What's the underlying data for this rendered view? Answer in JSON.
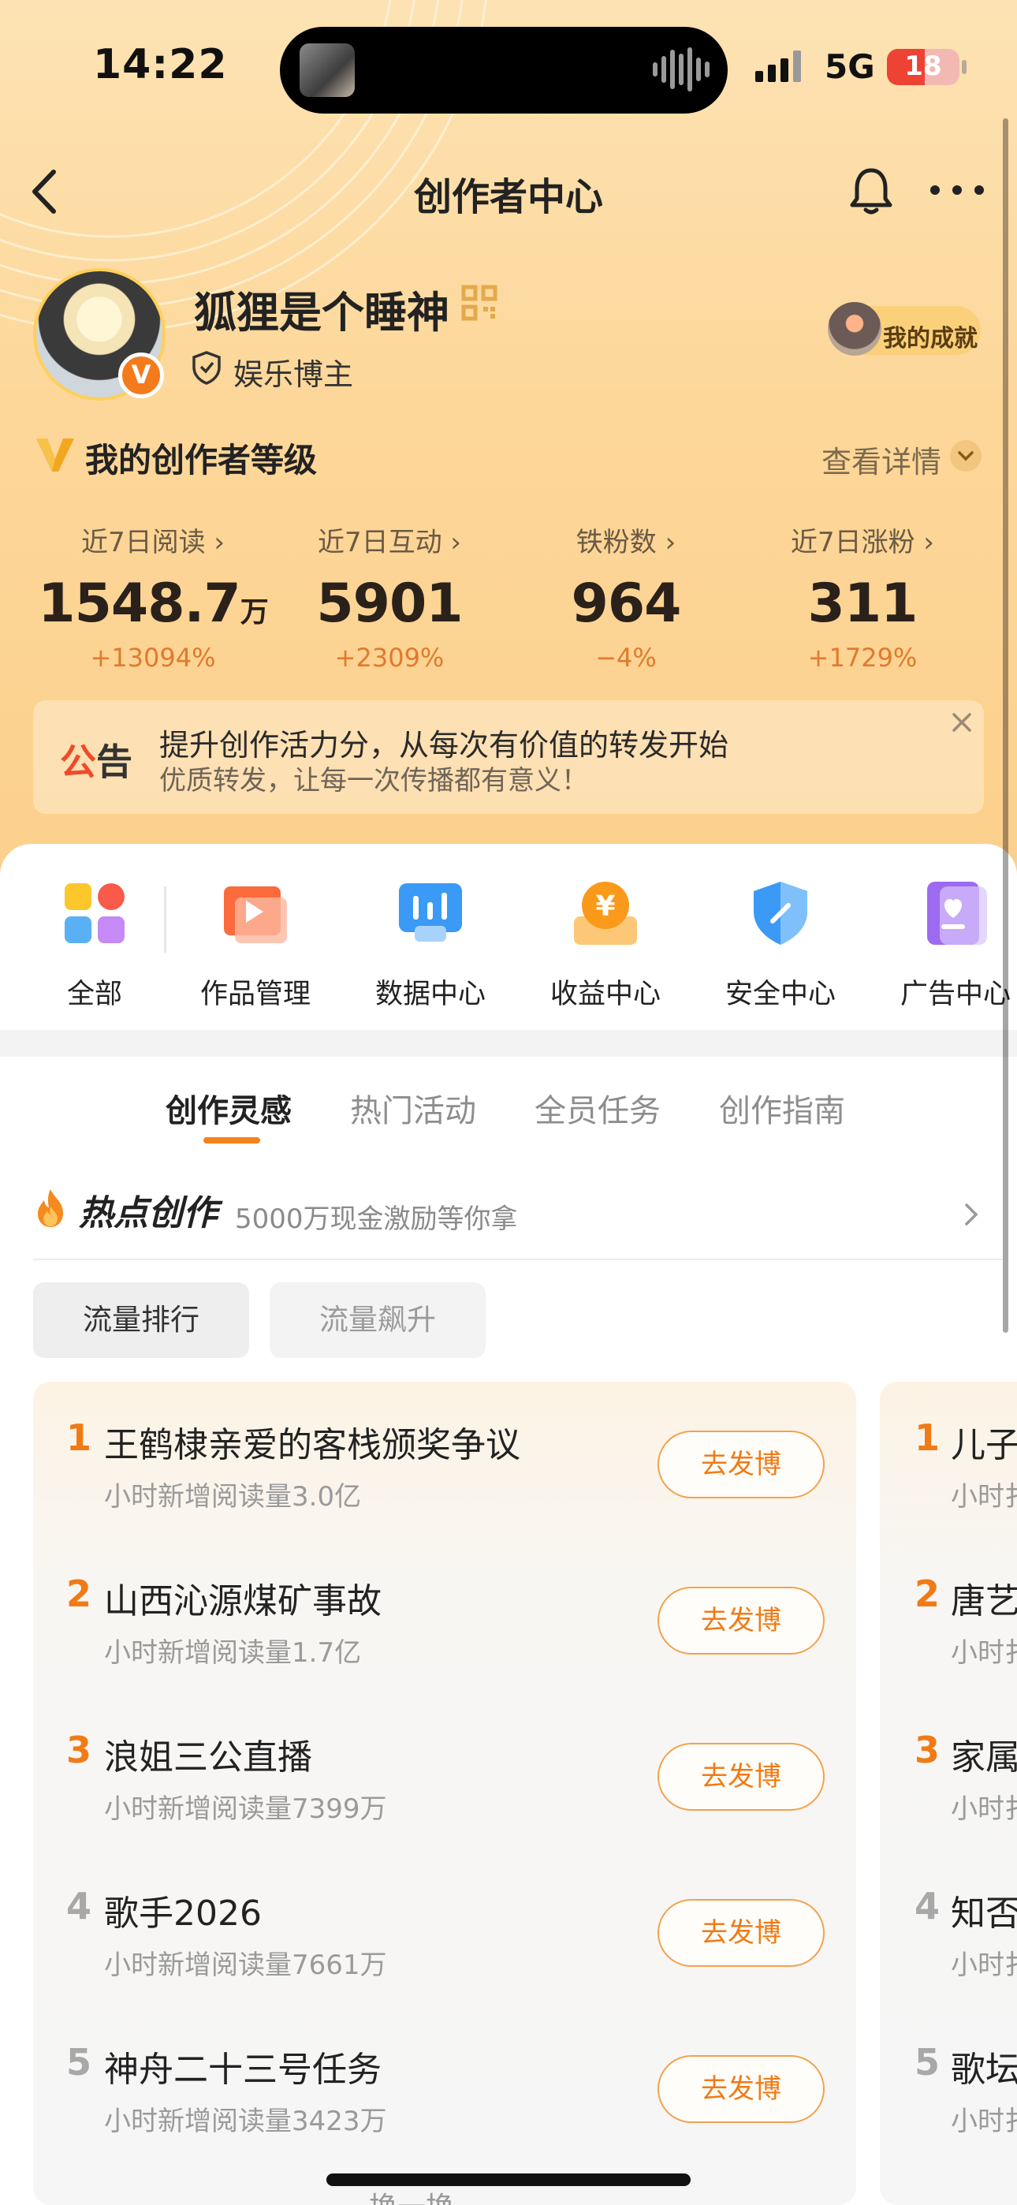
{
  "status_bar": {
    "time": "14:22",
    "network": "5G",
    "battery": "18"
  },
  "nav": {
    "title": "创作者中心",
    "back_icon": "chevron-left-icon",
    "bell_icon": "bell-icon",
    "more_icon": "more-dots-icon"
  },
  "profile": {
    "username": "狐狸是个睡神",
    "verified_badge": "V",
    "role": "娱乐博主",
    "achievement_label": "我的成就"
  },
  "level": {
    "title": "我的创作者等级",
    "detail_label": "查看详情"
  },
  "stats": [
    {
      "label": "近7日阅读 ›",
      "value": "1548.7",
      "unit": "万",
      "change": "+13094%"
    },
    {
      "label": "近7日互动 ›",
      "value": "5901",
      "unit": "",
      "change": "+2309%"
    },
    {
      "label": "铁粉数 ›",
      "value": "964",
      "unit": "",
      "change": "−4%"
    },
    {
      "label": "近7日涨粉 ›",
      "value": "311",
      "unit": "",
      "change": "+1729%"
    }
  ],
  "notice": {
    "tag_part1": "公",
    "tag_part2": "告",
    "line1": "提升创作活力分，从每次有价值的转发开始",
    "line2": "优质转发，让每一次传播都有意义！"
  },
  "tools": [
    {
      "label": "全部",
      "icon": "grid-dots-icon"
    },
    {
      "label": "作品管理",
      "icon": "video-play-icon"
    },
    {
      "label": "数据中心",
      "icon": "bar-chart-icon"
    },
    {
      "label": "收益中心",
      "icon": "yen-coin-icon"
    },
    {
      "label": "安全中心",
      "icon": "shield-icon"
    },
    {
      "label": "广告中心",
      "icon": "ad-heart-icon"
    }
  ],
  "tabs": [
    "创作灵感",
    "热门活动",
    "全员任务",
    "创作指南"
  ],
  "hot": {
    "title": "热点创作",
    "subtitle": "5000万现金激励等你拿"
  },
  "filters": [
    "流量排行",
    "流量飙升"
  ],
  "post_button_label": "去发博",
  "ranking": [
    {
      "rank": "1",
      "title": "王鹤棣亲爱的客栈颁奖争议",
      "sub": "小时新增阅读量3.0亿"
    },
    {
      "rank": "2",
      "title": "山西沁源煤矿事故",
      "sub": "小时新增阅读量1.7亿"
    },
    {
      "rank": "3",
      "title": "浪姐三公直播",
      "sub": "小时新增阅读量7399万"
    },
    {
      "rank": "4",
      "title": "歌手2026",
      "sub": "小时新增阅读量7661万"
    },
    {
      "rank": "5",
      "title": "神舟二十三号任务",
      "sub": "小时新增阅读量3423万"
    }
  ],
  "ranking2": [
    {
      "rank": "1",
      "title": "儿子",
      "sub": "小时扌"
    },
    {
      "rank": "2",
      "title": "唐艺",
      "sub": "小时扌"
    },
    {
      "rank": "3",
      "title": "家属",
      "sub": "小时扌"
    },
    {
      "rank": "4",
      "title": "知否",
      "sub": "小时扌"
    },
    {
      "rank": "5",
      "title": "歌坛",
      "sub": "小时扌"
    }
  ],
  "refresh_label": "换一换",
  "colors": {
    "accent": "#f5821f",
    "rank_top": "#f07b16",
    "rank_other": "#9a9a9a",
    "header_bg": "#fdd79a"
  }
}
